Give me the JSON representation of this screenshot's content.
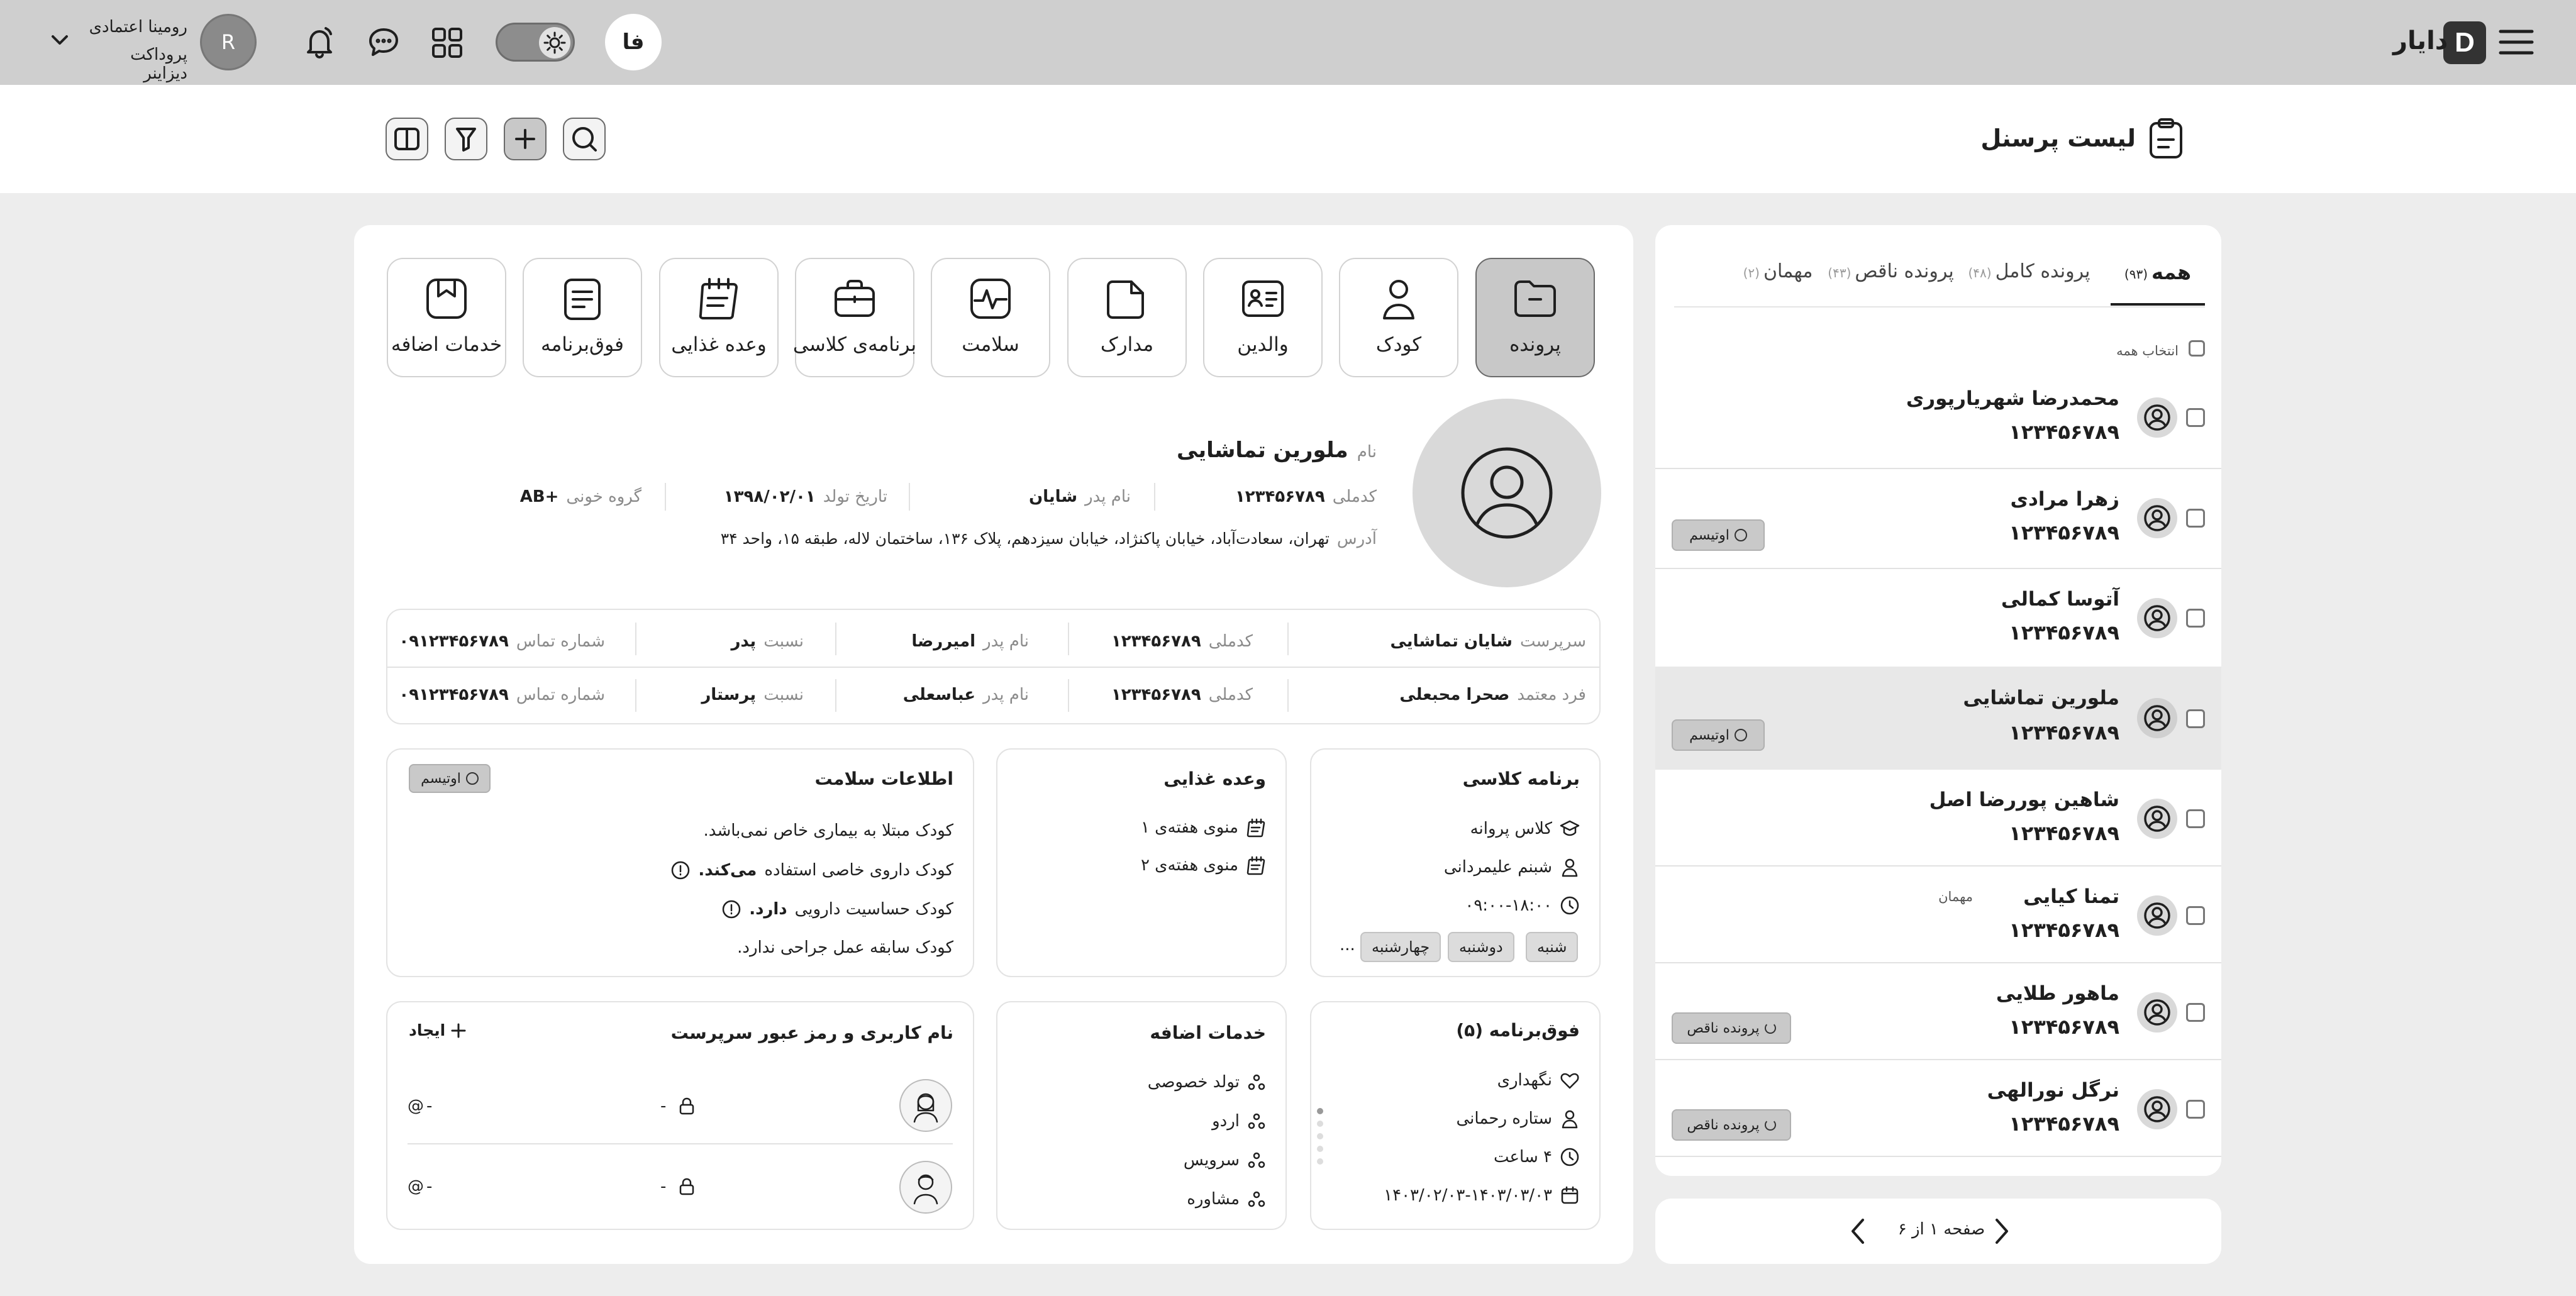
{
  "header": {
    "brand_name": "دایار",
    "lang_button": "فا",
    "user": {
      "avatar_initial": "R",
      "name": "رومینا اعتمادی",
      "role": "پروداکت دیزاینر"
    }
  },
  "page": {
    "title": "لیست پرسنل"
  },
  "list": {
    "tabs": [
      {
        "label": "همه",
        "count": "(۹۳)"
      },
      {
        "label": "پرونده کامل",
        "count": "(۴۸)"
      },
      {
        "label": "پرونده ناقص",
        "count": "(۴۳)"
      },
      {
        "label": "مهمان",
        "count": "(۲)"
      }
    ],
    "select_all": "انتخاب همه",
    "rows": [
      {
        "name": "محمدرضا شهریارپوری",
        "code": "۱۲۳۴۵۶۷۸۹",
        "chip": "",
        "guest": ""
      },
      {
        "name": "زهرا مرادی",
        "code": "۱۲۳۴۵۶۷۸۹",
        "chip": "اوتیسم",
        "guest": ""
      },
      {
        "name": "آتوسا کمالی",
        "code": "۱۲۳۴۵۶۷۸۹",
        "chip": "",
        "guest": ""
      },
      {
        "name": "ملورین تماشایی",
        "code": "۱۲۳۴۵۶۷۸۹",
        "chip": "اوتیسم",
        "guest": ""
      },
      {
        "name": "شاهین پوررضا اصل",
        "code": "۱۲۳۴۵۶۷۸۹",
        "chip": "",
        "guest": ""
      },
      {
        "name": "تمنا کیایی",
        "code": "۱۲۳۴۵۶۷۸۹",
        "chip": "",
        "guest": "مهمان"
      },
      {
        "name": "ماهور طلایی",
        "code": "۱۲۳۴۵۶۷۸۹",
        "chip": "پرونده ناقص",
        "guest": ""
      },
      {
        "name": "نرگل نورالهی",
        "code": "۱۲۳۴۵۶۷۸۹",
        "chip": "پرونده ناقص",
        "guest": ""
      }
    ],
    "pagination": "صفحه ۱ از ۶"
  },
  "detail": {
    "tiles": [
      "پرونده",
      "کودک",
      "والدین",
      "مدارک",
      "سلامت",
      "برنامه‌ی کلاسی",
      "وعده غذایی",
      "فوق‌برنامه",
      "خدمات اضافه"
    ],
    "profile": {
      "name_label": "نام",
      "name": "ملورین تماشایی",
      "code_label": "کدملی",
      "code": "۱۲۳۴۵۶۷۸۹",
      "father_label": "نام پدر",
      "father": "شایان",
      "birth_label": "تاریخ تولد",
      "birth": "۱۳۹۸/۰۲/۰۱",
      "blood_label": "گروه خونی",
      "blood": "AB+",
      "address_label": "آدرس",
      "address": "تهران، سعادت‌آباد، خیابان پاکنژاد، خیابان سیزدهم، پلاک ۱۳۶، ساختمان لاله، طبقه ۱۵، واحد ۳۴"
    },
    "guardians": [
      {
        "role_label": "سرپرست",
        "name": "شایان تماشایی",
        "code_label": "کدملی",
        "code": "۱۲۳۴۵۶۷۸۹",
        "father_label": "نام پدر",
        "father": "امیررضا",
        "rel_label": "نسبت",
        "rel": "پدر",
        "phone_label": "شماره تماس",
        "phone": "۰۹۱۲۳۴۵۶۷۸۹"
      },
      {
        "role_label": "فرد معتمد",
        "name": "صحرا محبعلی",
        "code_label": "کدملی",
        "code": "۱۲۳۴۵۶۷۸۹",
        "father_label": "نام پدر",
        "father": "عباسعلی",
        "rel_label": "نسبت",
        "rel": "پرستار",
        "phone_label": "شماره تماس",
        "phone": "۰۹۱۲۳۴۵۶۷۸۹"
      }
    ],
    "class": {
      "title": "برنامه کلاسی",
      "items": [
        "کلاس پروانه",
        "شبنم علیمردانی",
        "۰۹:۰۰-۱۸:۰۰"
      ],
      "days": [
        "شنبه",
        "دوشنبه",
        "چهارشنبه"
      ],
      "more": "..."
    },
    "meal": {
      "title": "وعده غذایی",
      "items": [
        "منوی هفته‌ی ۱",
        "منوی هفته‌ی ۲"
      ]
    },
    "health": {
      "title": "اطلاعات سلامت",
      "chip": "اوتیسم",
      "line1": "کودک مبتلا به بیماری خاص نمی‌باشد.",
      "line2_pre": "کودک داروی خاصی استفاده",
      "line2_bold": "می‌کند.",
      "line3_pre": "کودک حساسیت دارویی",
      "line3_bold": "دارد.",
      "line4": "کودک سابقه عمل جراحی ندارد."
    },
    "extra_program": {
      "title": "فوق‌برنامه (۵)",
      "items": [
        "نگهداری",
        "ستاره رحمانی",
        "۴ ساعت",
        "۱۴۰۳/۰۲/۰۳-۱۴۰۳/۰۳/۰۳"
      ]
    },
    "services": {
      "title": "خدمات اضافه",
      "items": [
        "تولد خصوصی",
        "اردو",
        "سرویس",
        "مشاوره"
      ]
    },
    "accounts": {
      "title": "نام کاربری و رمز عبور سرپرست",
      "create": "ایجاد",
      "rows": [
        {
          "user": "-",
          "pass": "-"
        },
        {
          "user": "-",
          "pass": "-"
        }
      ]
    }
  }
}
